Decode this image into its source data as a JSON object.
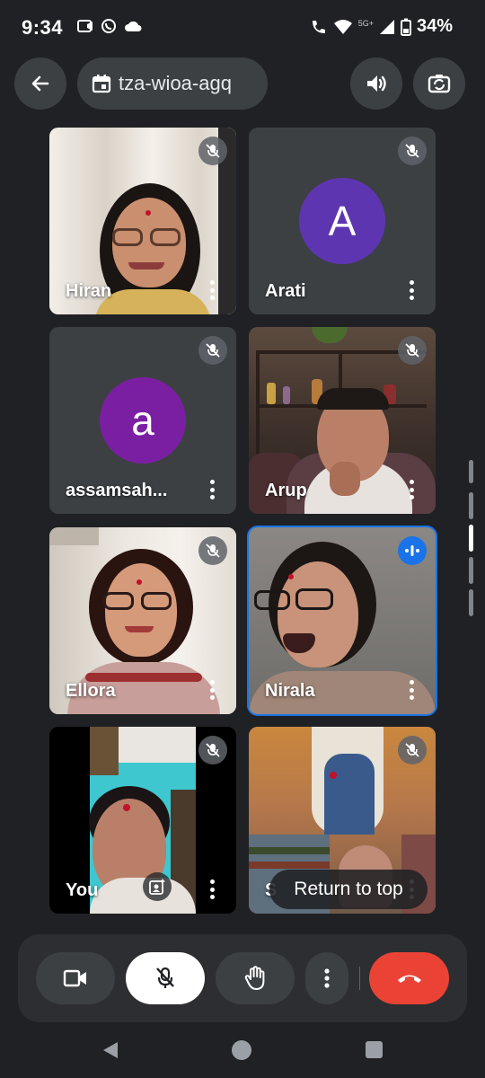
{
  "status_bar": {
    "time": "9:34",
    "network": "5G+",
    "battery": "34%",
    "left_icons": [
      "screen-cast-icon",
      "whatsapp-icon",
      "cloud-icon"
    ],
    "right_icons": [
      "wifi-calling-icon",
      "wifi-icon",
      "signal-icon",
      "battery-icon"
    ]
  },
  "top_bar": {
    "meeting_code": "tza-wioa-agq",
    "icons": [
      "back-arrow-icon",
      "calendar-icon",
      "speaker-icon",
      "switch-camera-icon"
    ]
  },
  "participants": [
    {
      "name": "Hiran",
      "muted": true,
      "type": "video"
    },
    {
      "name": "Arati",
      "muted": true,
      "type": "avatar",
      "initial": "A",
      "avatar_color": "#5e35b1"
    },
    {
      "name": "assamsah...",
      "muted": true,
      "type": "avatar",
      "initial": "a",
      "avatar_color": "#7b1fa2"
    },
    {
      "name": "Arup",
      "muted": true,
      "type": "video"
    },
    {
      "name": "Ellora",
      "muted": true,
      "type": "video"
    },
    {
      "name": "Nirala",
      "muted": false,
      "speaking": true,
      "type": "video"
    },
    {
      "name": "You",
      "muted": true,
      "type": "video"
    },
    {
      "name": "S",
      "muted": true,
      "type": "video"
    }
  ],
  "return_to_top": "Return to top",
  "controls": {
    "icons": [
      "camera-icon",
      "mic-off-icon",
      "raise-hand-icon",
      "more-vert-icon",
      "end-call-icon"
    ]
  },
  "colors": {
    "background": "#202124",
    "surface": "#3c4043",
    "speaking_accent": "#1a73e8",
    "end_call": "#ea4335"
  }
}
